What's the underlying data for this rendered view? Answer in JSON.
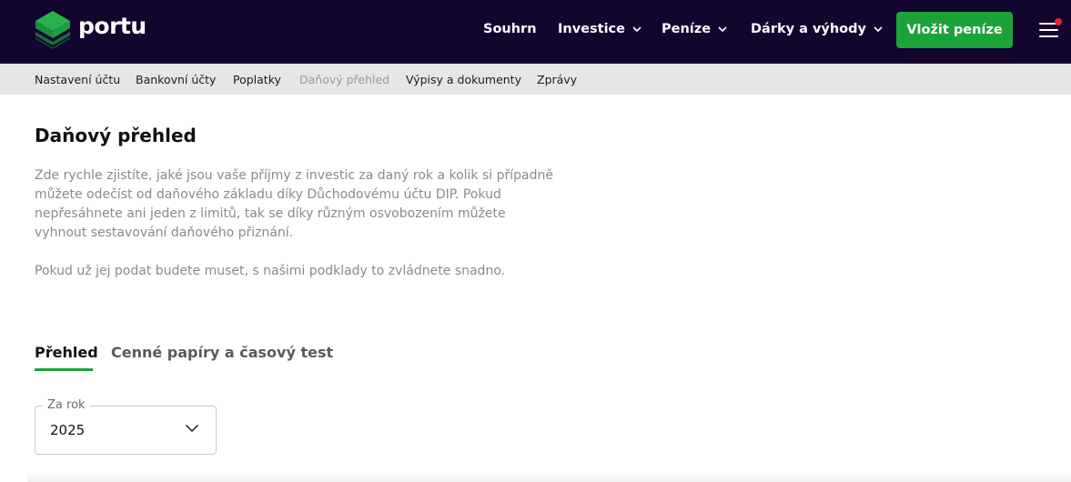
{
  "brand": {
    "name": "portu"
  },
  "nav": {
    "items": [
      {
        "label": "Souhrn",
        "has_dropdown": false
      },
      {
        "label": "Investice",
        "has_dropdown": true
      },
      {
        "label": "Peníze",
        "has_dropdown": true
      },
      {
        "label": "Dárky a výhody",
        "has_dropdown": true
      }
    ],
    "cta_label": "Vložit peníze",
    "menu_icon": "hamburger-icon",
    "notification_color": "#e5232b"
  },
  "subnav": {
    "items": [
      {
        "label": "Nastavení účtu",
        "active": false
      },
      {
        "label": "Bankovní účty",
        "active": false
      },
      {
        "label": "Poplatky",
        "active": false
      },
      {
        "label": "Daňový přehled",
        "active": true
      },
      {
        "label": "Výpisy a dokumenty",
        "active": false
      },
      {
        "label": "Zprávy",
        "active": false
      }
    ]
  },
  "main": {
    "title": "Daňový přehled",
    "intro_lines": [
      "Zde rychle zjistíte, jaké jsou vaše příjmy z investic za daný rok a kolik si případně",
      "můžete odečíst od daňového základu díky Důchodovému účtu DIP. Pokud",
      "nepřesáhnete ani jeden z limitů, tak se díky různým osvobozením můžete",
      "vyhnout sestavování daňového přiznání."
    ],
    "intro_second": "Pokud už jej podat budete muset, s našimi podklady to zvládnete snadno.",
    "tabs": [
      {
        "label": "Přehled",
        "active": true
      },
      {
        "label": "Cenné papíry a časový test",
        "active": false
      }
    ],
    "year_select": {
      "label": "Za rok",
      "value": "2025"
    }
  },
  "colors": {
    "topbar": "#12052e",
    "accent": "#1ba339",
    "subnav_bg": "#e6e6e6"
  }
}
